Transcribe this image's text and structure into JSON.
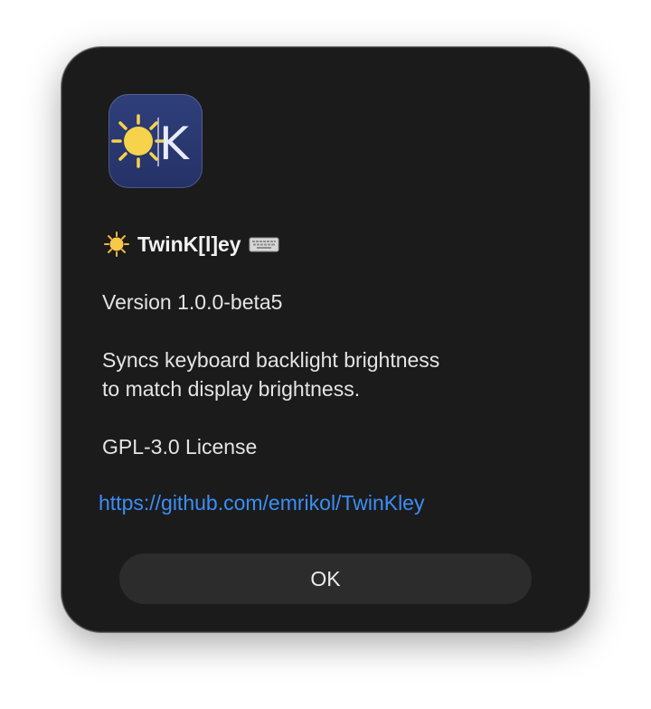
{
  "dialog": {
    "app_icon": {
      "icon": "sun-keyboard-app-icon",
      "letter": "K",
      "colors": {
        "background": "#2a3870",
        "sun": "#f6d34a",
        "letter": "#e8ebff"
      }
    },
    "title": {
      "leading_icon": "sun-icon",
      "text": "TwinK[l]ey",
      "trailing_icon": "keyboard-icon"
    },
    "version": "Version 1.0.0-beta5",
    "description_lines": [
      "Syncs keyboard backlight brightness",
      "to match display brightness."
    ],
    "license": "GPL-3.0 License",
    "link": "https://github.com/emrikol/TwinKley",
    "ok_button_label": "OK"
  },
  "colors": {
    "dialog_background": "#1b1b1b",
    "link": "#3b8ef5",
    "button_background": "#2c2c2c"
  }
}
